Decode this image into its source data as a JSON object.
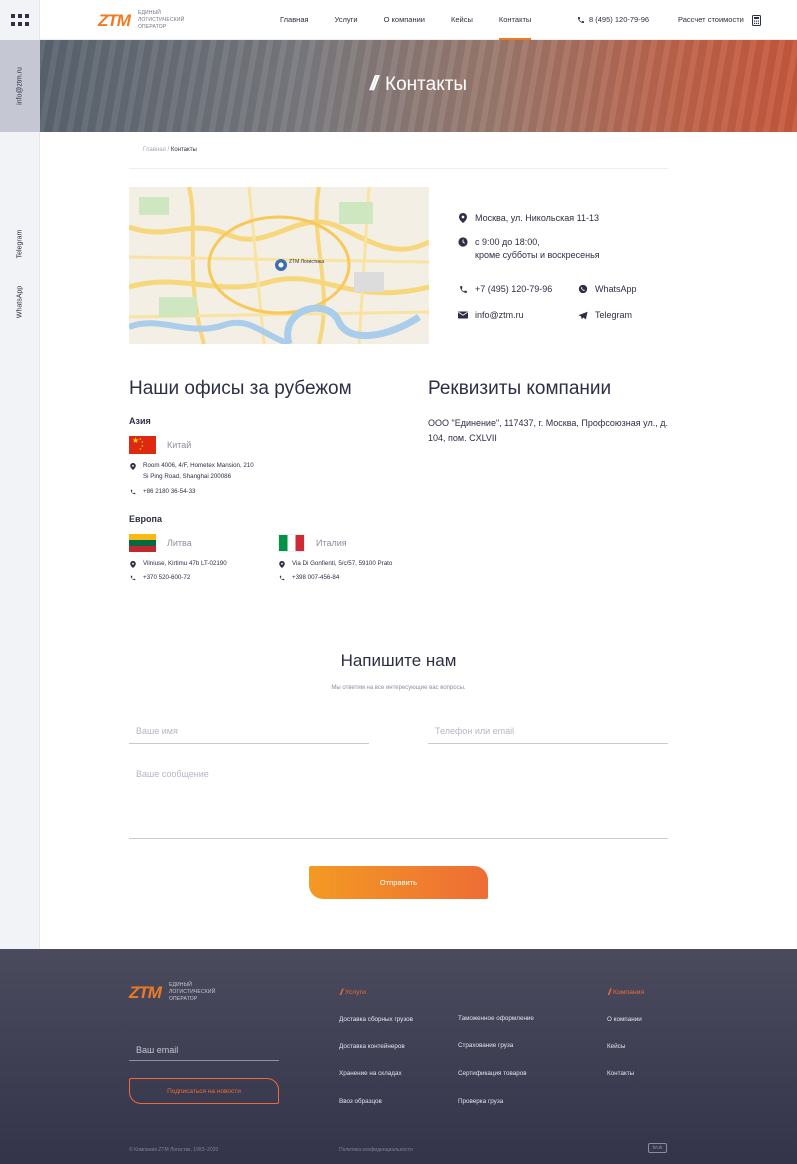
{
  "rail": {
    "email": "info@ztm.ru",
    "telegram": "Telegram",
    "whatsapp": "WhatsApp"
  },
  "header": {
    "logo": "ZTM",
    "logo_caption": "Единый логистический оператор",
    "nav": [
      "Главная",
      "Услуги",
      "О компании",
      "Кейсы",
      "Контакты"
    ],
    "active_nav": "Контакты",
    "phone": "8 (495) 120-79-96",
    "calc": "Рассчет стоимости"
  },
  "hero": {
    "title": "Контакты"
  },
  "breadcrumb": {
    "home": "Главная",
    "separator": "/",
    "current": "Контакты"
  },
  "contacts": {
    "address": "Москва, ул. Никольская 11-13",
    "hours_line1": "с 9:00 до 18:00,",
    "hours_line2": "кроме субботы и воскресенья",
    "phone": "+7 (495) 120-79-96",
    "whatsapp": "WhatsApp",
    "email": "info@ztm.ru",
    "telegram": "Telegram",
    "map_pin_label": "ZTM Логистика"
  },
  "offices": {
    "title": "Наши офисы за рубежом",
    "asia_label": "Азия",
    "china": {
      "name": "Китай",
      "address_line1": "Room 4006, 4/F, Hometex Mansion, 210",
      "address_line2": "Si Ping Road, Shanghai 200086",
      "phone": "+86 2180 36-54-33"
    },
    "europe_label": "Европа",
    "lithuania": {
      "name": "Литва",
      "address": "Vilniuse, Kirtimu 47b LT-02190",
      "phone": "+370 520-600-72"
    },
    "italy": {
      "name": "Италия",
      "address": "Via Di Gonfienti, 5/c/57, 59100 Prato",
      "phone": "+398 007-456-84"
    }
  },
  "requisites": {
    "title": "Реквизиты компании",
    "text": "ООО \"Единение\", 117437, г. Москва, Профсоюзная ул., д. 104, пом. CXLVII"
  },
  "form": {
    "title": "Напишите нам",
    "subtitle": "Мы ответим на все интересующие вас вопросы.",
    "name_placeholder": "Ваше имя",
    "contact_placeholder": "Телефон или email",
    "message_placeholder": "Ваше сообщение",
    "submit": "Отправить"
  },
  "footer": {
    "logo": "ZTM",
    "logo_caption": "Единый логистический оператор",
    "email_placeholder": "Ваш email",
    "subscribe": "Подписаться на новости",
    "services_title": "Услуги",
    "services_col1": [
      "Доставка сборных грузов",
      "Доставка контейнеров",
      "Хранение на складах",
      "Ввоз образцов"
    ],
    "services_col2": [
      "Таможенное оформление",
      "Страхование груза",
      "Сертификация товаров",
      "Проверка груза"
    ],
    "company_title": "Компания",
    "company_links": [
      "О компании",
      "Кейсы",
      "Контакты"
    ],
    "copyright": "© Компания ZTM Логистик, 1993–2020",
    "privacy": "Политика конфиденциальности",
    "badge": "bruk"
  },
  "colors": {
    "accent": "#f07a22",
    "accent_dark": "#ee6d35",
    "text": "#2d2f45",
    "footer_bg": "#3b3c50"
  }
}
